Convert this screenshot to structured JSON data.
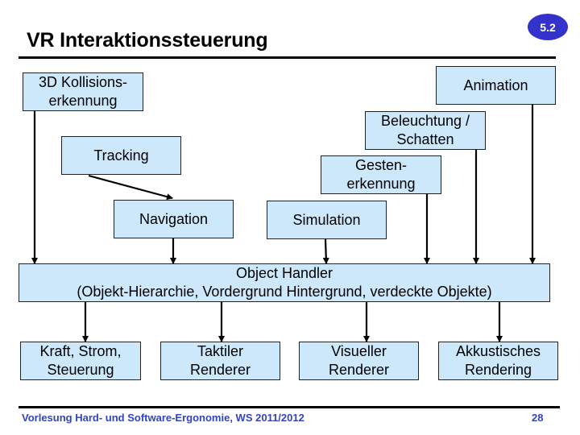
{
  "slide": {
    "title": "VR Interaktionssteuerung",
    "badge": "5.2",
    "footer": "Vorlesung Hard- und Software-Ergonomie, WS 2011/2012",
    "page_number": "28",
    "colors": {
      "box_fill": "#cce8fa",
      "badge": "#3333cc",
      "footer_text": "#3344bb"
    }
  },
  "inputs": {
    "kollision": "3D Kollisions-\nerkennung",
    "animation": "Animation",
    "beleuchtung": "Beleuchtung /\nSchatten",
    "tracking": "Tracking",
    "gesten": "Gesten-\nerkennung",
    "navigation": "Navigation",
    "simulation": "Simulation"
  },
  "handler": {
    "title": "Object Handler",
    "subtitle": "(Objekt-Hierarchie, Vordergrund Hintergrund, verdeckte Objekte)"
  },
  "outputs": {
    "kraft": "Kraft, Strom,\nSteuerung",
    "taktil": "Taktiler\nRenderer",
    "visuell": "Visueller\nRenderer",
    "akustisch": "Akkustisches\nRendering"
  },
  "edges": [
    {
      "from": "Tracking",
      "to": "Navigation"
    },
    {
      "from": "3D Kollisionserkennung",
      "to": "Object Handler"
    },
    {
      "from": "Navigation",
      "to": "Object Handler"
    },
    {
      "from": "Simulation",
      "to": "Object Handler"
    },
    {
      "from": "Gestenerkennung",
      "to": "Object Handler"
    },
    {
      "from": "Beleuchtung / Schatten",
      "to": "Object Handler"
    },
    {
      "from": "Animation",
      "to": "Object Handler"
    },
    {
      "from": "Object Handler",
      "to": "Kraft, Strom, Steuerung"
    },
    {
      "from": "Object Handler",
      "to": "Taktiler Renderer"
    },
    {
      "from": "Object Handler",
      "to": "Visueller Renderer"
    },
    {
      "from": "Object Handler",
      "to": "Akkustisches Rendering"
    }
  ]
}
